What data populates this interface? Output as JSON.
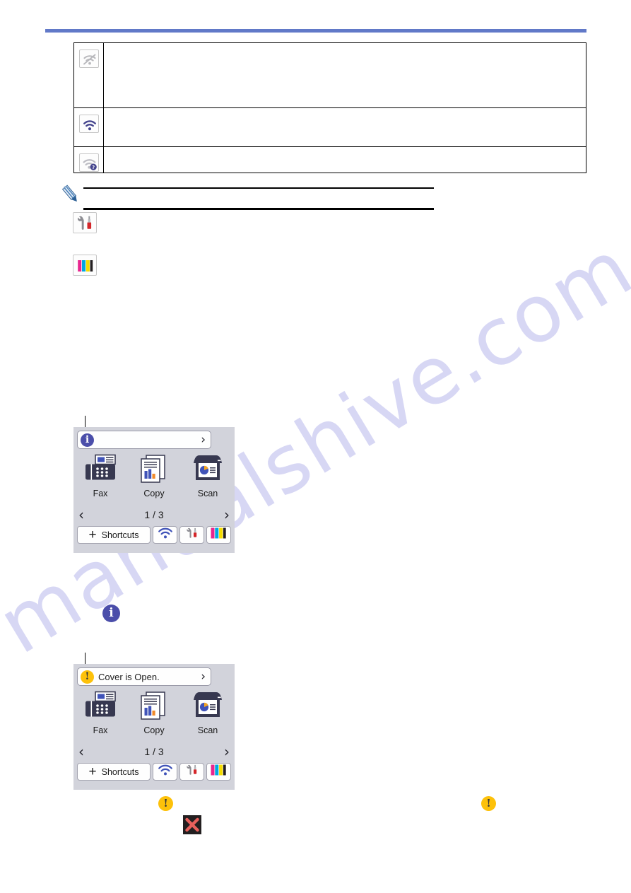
{
  "page": {
    "watermark_text": "manualshive.com",
    "rule_color": "#6179C8"
  },
  "status_icon_table": {
    "rows": [
      {
        "icon": "wifi-disabled-icon",
        "description": ""
      },
      {
        "icon": "wifi-connected-icon",
        "description": ""
      },
      {
        "icon": "wifi-error-icon",
        "description": ""
      }
    ]
  },
  "note": {
    "icon": "pencil-note-icon",
    "text": "",
    "inline_icons": [
      {
        "name": "settings-icon",
        "label": "Settings"
      },
      {
        "name": "ink-cartridge-icon",
        "label": "Ink"
      }
    ]
  },
  "lcd_screens": [
    {
      "id": "home-screen-info",
      "callout": true,
      "status_bar": {
        "badge": "info-icon",
        "badge_glyph": "i",
        "message": "",
        "chevron": "›"
      },
      "apps": [
        {
          "label": "Fax",
          "icon": "fax-icon"
        },
        {
          "label": "Copy",
          "icon": "copy-icon"
        },
        {
          "label": "Scan",
          "icon": "scan-icon"
        }
      ],
      "pager": {
        "prev": "‹",
        "count": "1 / 3",
        "next": "›"
      },
      "toolbar": {
        "plus": "+",
        "shortcuts_label": "Shortcuts",
        "buttons": [
          {
            "name": "wifi-icon"
          },
          {
            "name": "settings-icon"
          },
          {
            "name": "ink-cartridge-icon"
          }
        ]
      }
    },
    {
      "id": "home-screen-warning",
      "callout": true,
      "status_bar": {
        "badge": "warning-icon",
        "badge_glyph": "!",
        "message": "Cover is Open.",
        "chevron": "›"
      },
      "apps": [
        {
          "label": "Fax",
          "icon": "fax-icon"
        },
        {
          "label": "Copy",
          "icon": "copy-icon"
        },
        {
          "label": "Scan",
          "icon": "scan-icon"
        }
      ],
      "pager": {
        "prev": "‹",
        "count": "1 / 3",
        "next": "›"
      },
      "toolbar": {
        "plus": "+",
        "shortcuts_label": "Shortcuts",
        "buttons": [
          {
            "name": "wifi-icon"
          },
          {
            "name": "settings-icon"
          },
          {
            "name": "ink-cartridge-icon"
          }
        ]
      }
    }
  ],
  "inline_info_icon": {
    "name": "info-icon",
    "glyph": "i"
  },
  "loose_glyphs": [
    {
      "name": "warning-icon",
      "glyph": "!"
    },
    {
      "name": "warning-icon",
      "glyph": "!"
    },
    {
      "name": "cancel-x-icon",
      "glyph": "✕"
    }
  ],
  "colors": {
    "accent_blue": "#6179C8",
    "info_badge": "#4B4EAA",
    "warning_badge": "#FDC10A",
    "lcd_background": "#D2D3DB",
    "icon_navy": "#373850",
    "x_red": "#E8605C"
  }
}
